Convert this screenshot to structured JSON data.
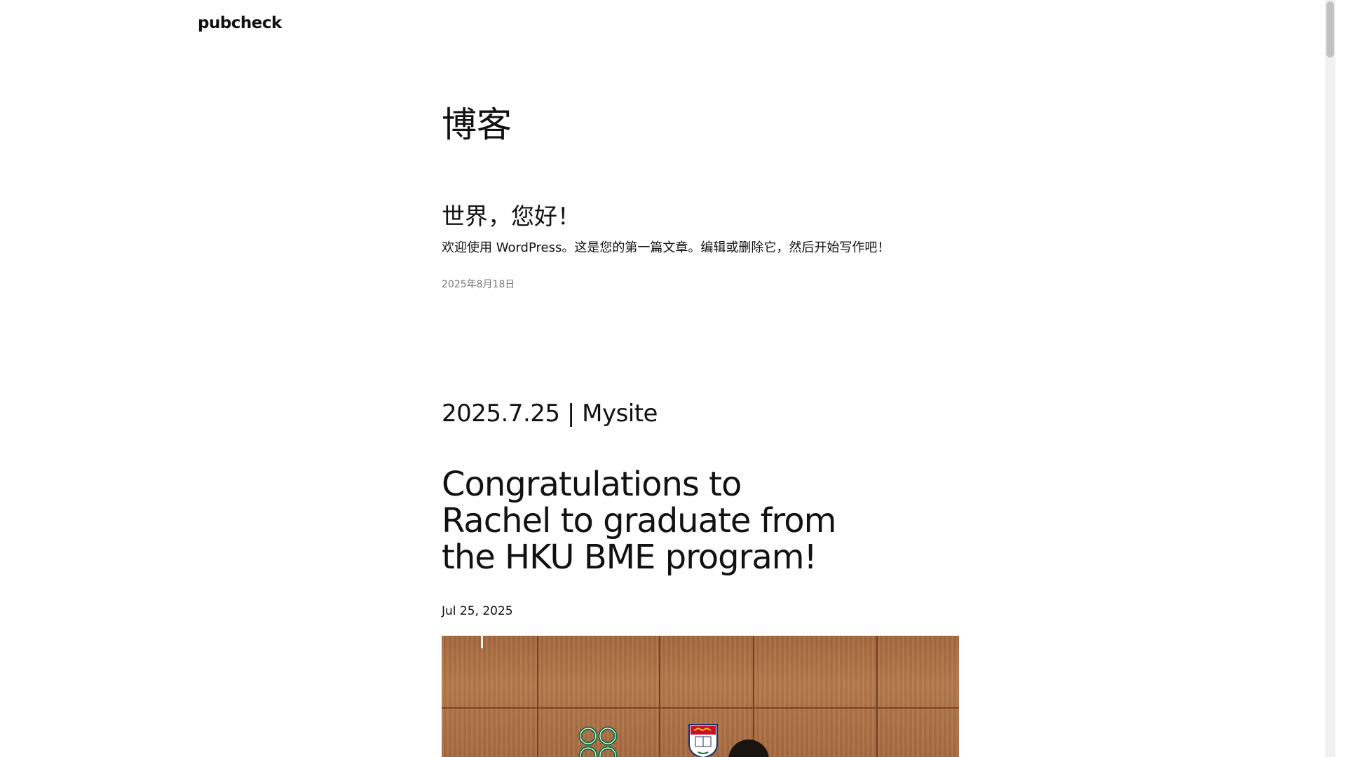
{
  "site": {
    "title": "pubcheck"
  },
  "page": {
    "heading": "博客"
  },
  "posts": [
    {
      "title": "世界，您好！",
      "excerpt": "欢迎使用 WordPress。这是您的第一篇文章。编辑或删除它，然后开始写作吧！",
      "date": "2025年8月18日"
    },
    {
      "title": "2025.7.25 | Mysite",
      "subtitle": "Congratulations to Rachel to graduate from the HKU BME program!",
      "date": "Jul 25, 2025",
      "image_alt": "featured-photo"
    }
  ],
  "colors": {
    "text": "#111111",
    "muted": "#777777",
    "background": "#ffffff"
  }
}
